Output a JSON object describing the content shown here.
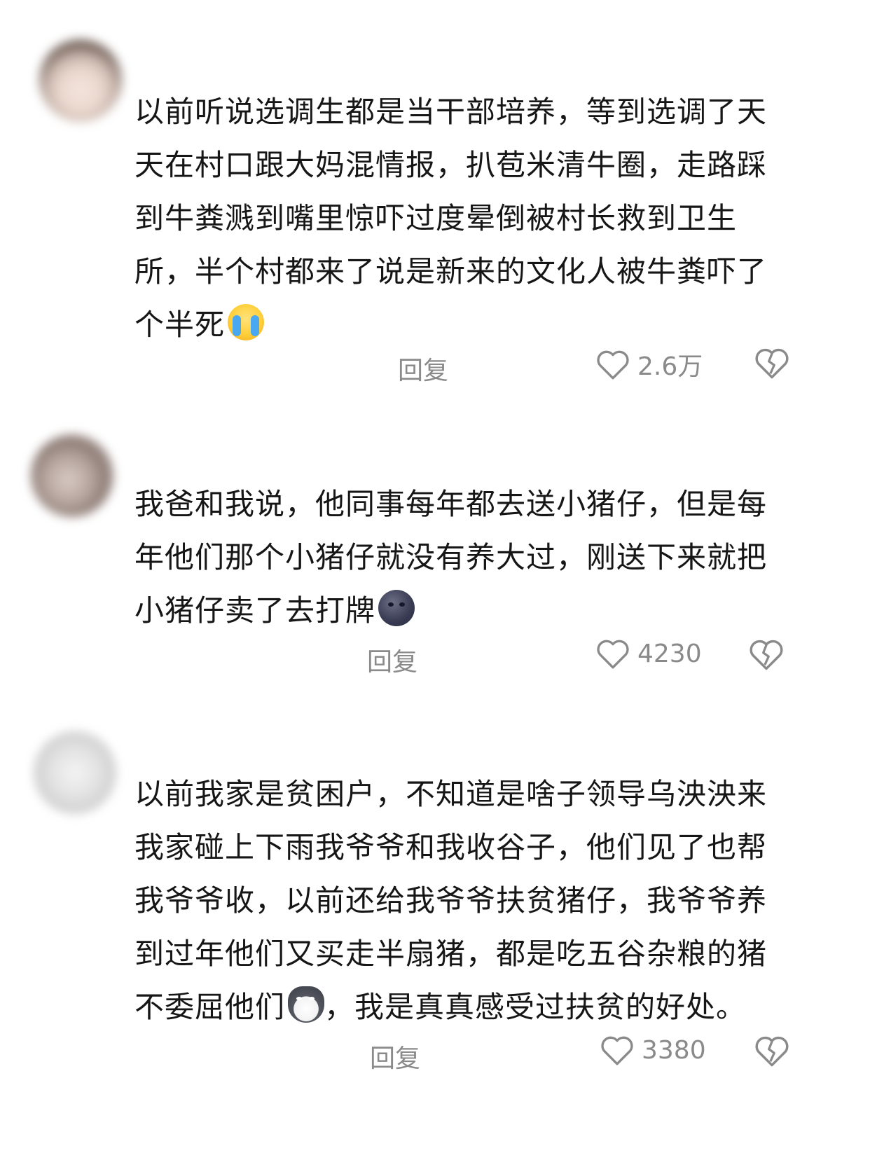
{
  "comments": [
    {
      "lines": [
        "以前听说选调生都是当干部培养，等到选调了天",
        "天在村口跟大妈混情报，扒苞米清牛圈，走路踩",
        "到牛粪溅到嘴里惊吓过度晕倒被村长救到卫生",
        "所，半个村都来了说是新来的文化人被牛粪吓了",
        "个半死"
      ],
      "emoji": "crying-emoji",
      "reply_label": "回复",
      "like_count": "2.6万"
    },
    {
      "lines": [
        "我爸和我说，他同事每年都去送小猪仔，但是每",
        "年他们那个小猪仔就没有养大过，刚送下来就把",
        "小猪仔卖了去打牌"
      ],
      "emoji": "dark-moon-emoji",
      "reply_label": "回复",
      "like_count": "4230"
    },
    {
      "lines": [
        "以前我家是贫困户，不知道是啥子领导乌泱泱来",
        "我家碰上下雨我爷爷和我收谷子，他们见了也帮",
        "我爷爷收，以前还给我爷爷扶贫猪仔，我爷爷养",
        "到过年他们又买走半扇猪，都是吃五谷杂粮的猪",
        "不委屈他们",
        "，我是真真感受过扶贫的好处。"
      ],
      "emoji": "husky-dog-emoji",
      "reply_label": "回复",
      "like_count": "3380"
    }
  ],
  "icons": {
    "like": "heart-outline-icon",
    "dislike": "broken-heart-icon"
  },
  "colors": {
    "text": "#161616",
    "meta": "#8a8a8a"
  }
}
